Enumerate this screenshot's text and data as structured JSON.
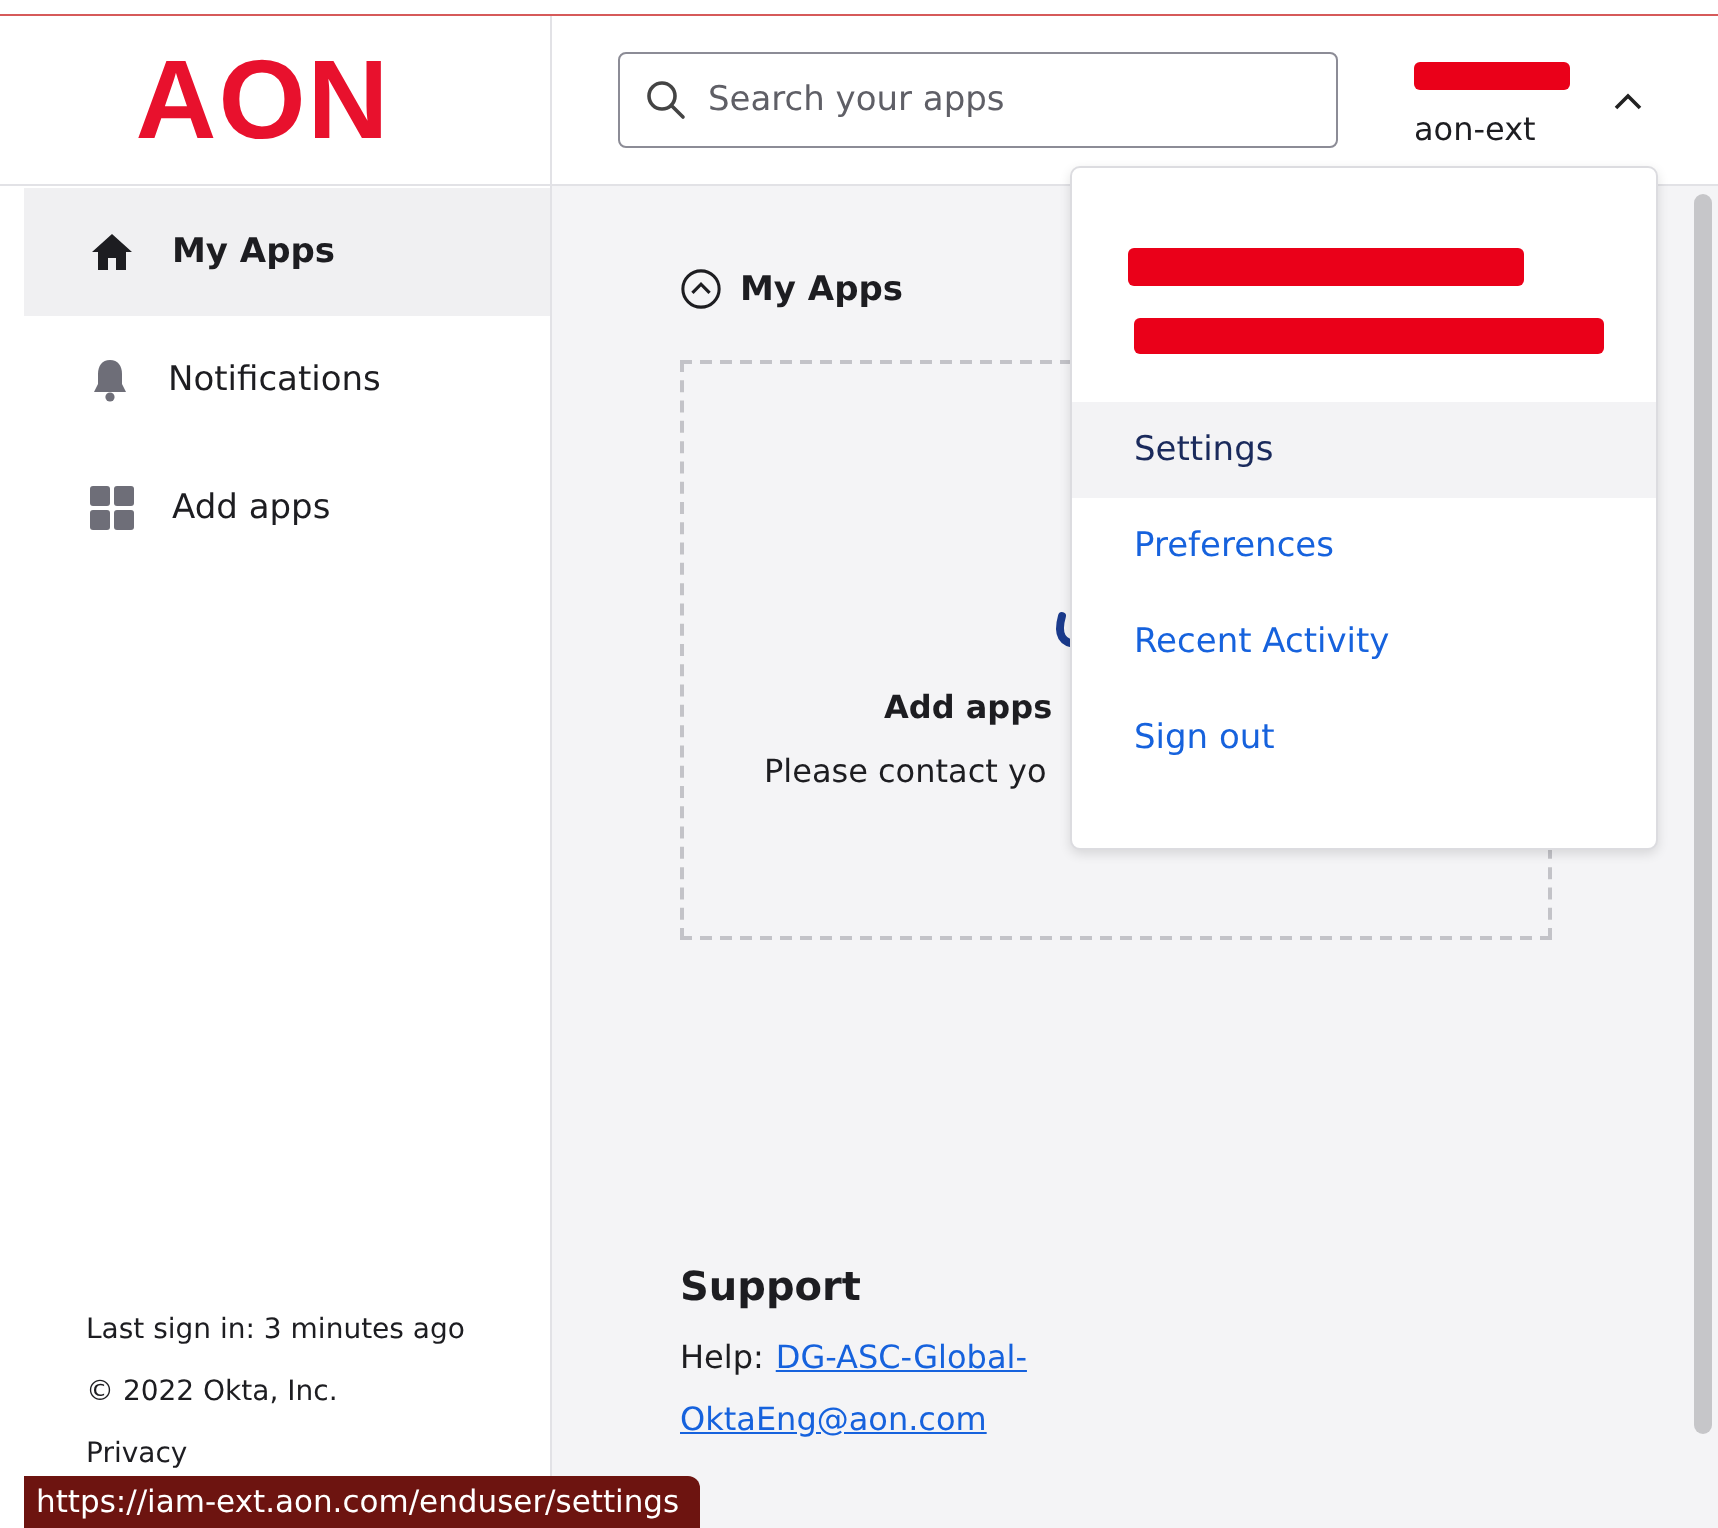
{
  "header": {
    "logo": "AON",
    "search": {
      "placeholder": "Search your apps"
    },
    "user": {
      "org": "aon-ext",
      "menu_open": true
    }
  },
  "sidebar": {
    "items": [
      {
        "label": "My Apps",
        "selected": true
      },
      {
        "label": "Notifications",
        "selected": false
      },
      {
        "label": "Add apps",
        "selected": false
      }
    ],
    "footer": [
      "Last sign in: 3 minutes ago",
      "© 2022 Okta, Inc.",
      "Privacy"
    ]
  },
  "main": {
    "section_title": "My Apps",
    "empty_state": {
      "title": "Add apps",
      "text": "Please contact yo"
    },
    "support": {
      "title": "Support",
      "label": "Help:",
      "link_lines": [
        "DG-ASC-Global-",
        "OktaEng@aon.com"
      ]
    }
  },
  "user_menu": {
    "items": [
      {
        "label": "Settings",
        "selected": true
      },
      {
        "label": "Preferences",
        "selected": false
      },
      {
        "label": "Recent Activity",
        "selected": false
      },
      {
        "label": "Sign out",
        "selected": false
      }
    ]
  },
  "status_url": "https://iam-ext.aon.com/enduser/settings"
}
